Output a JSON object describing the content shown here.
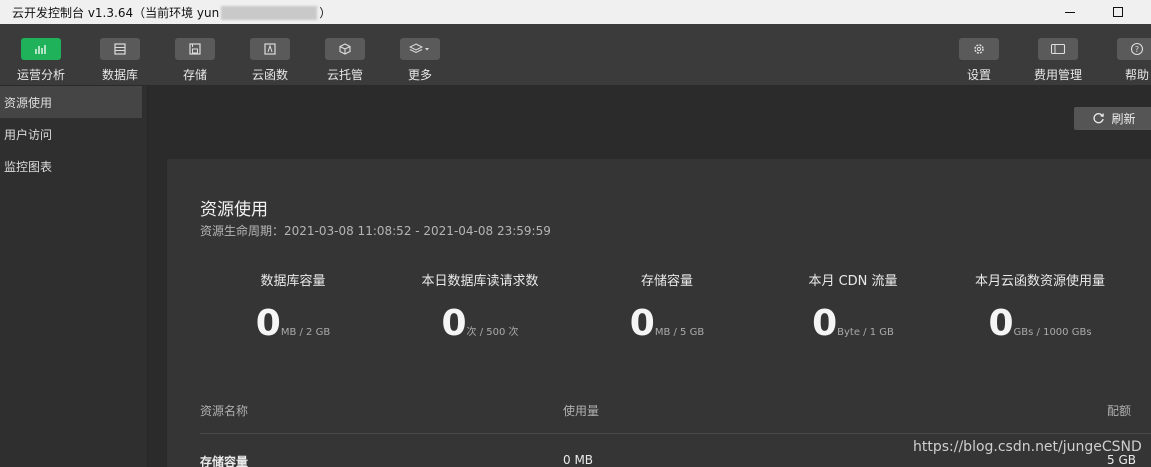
{
  "window": {
    "title_prefix": "云开发控制台 v1.3.64（当前环境 yun",
    "title_suffix": "）",
    "minimize_label": "–",
    "maximize_label": "□"
  },
  "toolbar": {
    "left_items": [
      {
        "label": "运营分析",
        "icon": "bar-chart-icon",
        "active": true
      },
      {
        "label": "数据库",
        "icon": "database-icon"
      },
      {
        "label": "存储",
        "icon": "storage-icon"
      },
      {
        "label": "云函数",
        "icon": "function-icon"
      },
      {
        "label": "云托管",
        "icon": "box-icon"
      },
      {
        "label": "更多",
        "icon": "layers-icon"
      }
    ],
    "right_items": [
      {
        "label": "设置",
        "icon": "gear-icon"
      },
      {
        "label": "费用管理",
        "icon": "billing-icon"
      },
      {
        "label": "帮助",
        "icon": "help-icon"
      }
    ]
  },
  "sidebar": {
    "items": [
      {
        "label": "资源使用",
        "active": true
      },
      {
        "label": "用户访问"
      },
      {
        "label": "监控图表"
      }
    ]
  },
  "main": {
    "refresh_label": "刷新",
    "panel_title": "资源使用",
    "lifecycle": "资源生命周期：2021-03-08 11:08:52 - 2021-04-08 23:59:59",
    "stats": [
      {
        "label": "数据库容量",
        "value": "0",
        "unit": "MB / 2 GB"
      },
      {
        "label": "本日数据库读请求数",
        "value": "0",
        "unit": "次 / 500 次"
      },
      {
        "label": "存储容量",
        "value": "0",
        "unit": "MB / 5 GB"
      },
      {
        "label": "本月 CDN 流量",
        "value": "0",
        "unit": "Byte / 1 GB"
      },
      {
        "label": "本月云函数资源使用量",
        "value": "0",
        "unit": "GBs / 1000 GBs"
      }
    ],
    "table": {
      "headers": [
        "资源名称",
        "使用量",
        "配额"
      ],
      "rows": [
        [
          "存储容量",
          "0 MB",
          "5 GB"
        ]
      ]
    }
  },
  "watermark": "https://blog.csdn.net/jungeCSND",
  "colors": {
    "accent": "#1fb25a",
    "toolbar_bg": "#3b3b3b",
    "panel_bg": "#353535"
  }
}
